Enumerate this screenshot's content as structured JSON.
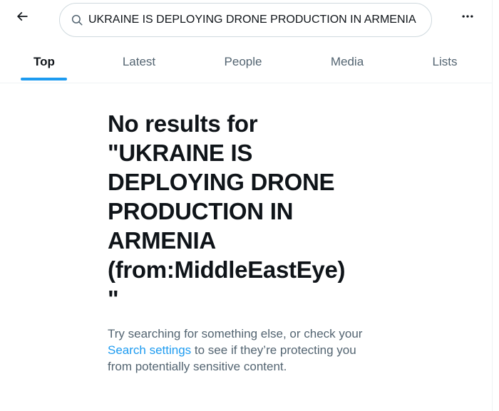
{
  "search": {
    "value": "UKRAINE IS DEPLOYING DRONE PRODUCTION IN ARMENIA (from:MiddleEastEye)",
    "icon": "search-icon"
  },
  "header": {
    "back_icon": "arrow-left-icon",
    "more_icon": "more-horizontal-icon"
  },
  "tabs": [
    {
      "label": "Top",
      "active": true
    },
    {
      "label": "Latest",
      "active": false
    },
    {
      "label": "People",
      "active": false
    },
    {
      "label": "Media",
      "active": false
    },
    {
      "label": "Lists",
      "active": false
    }
  ],
  "empty_state": {
    "title_line1": "No results for",
    "title_line2": "\"UKRAINE IS",
    "title_line3": "DEPLOYING DRONE",
    "title_line4": "PRODUCTION IN",
    "title_line5": "ARMENIA",
    "title_line6": "(from:MiddleEastEye)",
    "title_line7": "\"",
    "body_prefix": "Try searching for something else, or check your ",
    "body_link": "Search settings",
    "body_suffix": " to see if they’re protecting you from potentially sensitive content."
  },
  "colors": {
    "accent": "#1d9bf0",
    "text_primary": "#0f1419",
    "text_secondary": "#536471",
    "border": "#cfd9de"
  }
}
